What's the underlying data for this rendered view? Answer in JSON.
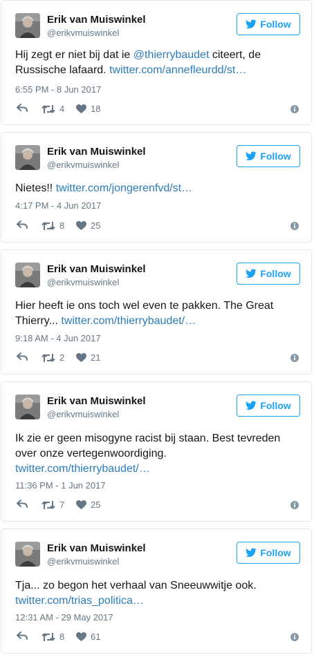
{
  "colors": {
    "accent": "#1da1f2",
    "link": "#2b7bb9",
    "text": "#14171a",
    "muted": "#657786",
    "border": "#e1e8ed"
  },
  "icons": {
    "reply": "reply-arrow-icon",
    "retweet": "retweet-icon",
    "like": "heart-icon",
    "info": "info-icon",
    "follow": "twitter-bird-icon"
  },
  "tweets": [
    {
      "author_name": "Erik van Muiswinkel",
      "author_handle": "@erikvmuiswinkel",
      "follow_label": "Follow",
      "text_before": "Hij zegt er niet bij dat ie ",
      "mention": "@thierrybaudet",
      "text_after": " citeert, de Russische lafaard. ",
      "link": "twitter.com/annefleurdd/st…",
      "timestamp": "6:55 PM - 8 Jun 2017",
      "retweets": "4",
      "likes": "18"
    },
    {
      "author_name": "Erik van Muiswinkel",
      "author_handle": "@erikvmuiswinkel",
      "follow_label": "Follow",
      "text_before": "Nietes!! ",
      "link": "twitter.com/jongerenfvd/st…",
      "timestamp": "4:17 PM - 4 Jun 2017",
      "retweets": "8",
      "likes": "25"
    },
    {
      "author_name": "Erik van Muiswinkel",
      "author_handle": "@erikvmuiswinkel",
      "follow_label": "Follow",
      "text_before": "Hier heeft ie ons toch wel even te pakken. The Great Thierry... ",
      "link": "twitter.com/thierrybaudet/…",
      "timestamp": "9:18 AM - 4 Jun 2017",
      "retweets": "2",
      "likes": "21"
    },
    {
      "author_name": "Erik van Muiswinkel",
      "author_handle": "@erikvmuiswinkel",
      "follow_label": "Follow",
      "text_before": "Ik zie er geen misogyne racist bij staan. Best tevreden over onze vertegenwoordiging. ",
      "link": "twitter.com/thierrybaudet/…",
      "timestamp": "11:36 PM - 1 Jun 2017",
      "retweets": "7",
      "likes": "25"
    },
    {
      "author_name": "Erik van Muiswinkel",
      "author_handle": "@erikvmuiswinkel",
      "follow_label": "Follow",
      "text_before": "Tja... zo begon het verhaal van Sneeuwwitje ook. ",
      "link": "twitter.com/trias_politica…",
      "timestamp": "12:31 AM - 29 May 2017",
      "retweets": "8",
      "likes": "61"
    }
  ]
}
